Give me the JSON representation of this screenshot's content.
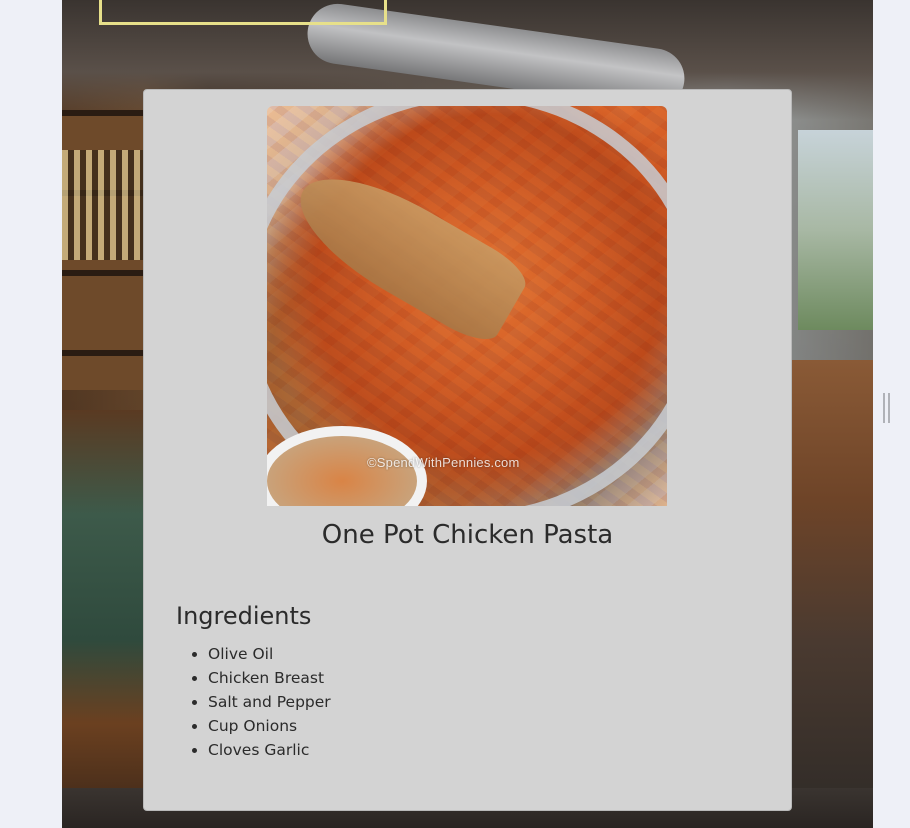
{
  "recipe": {
    "title": "One Pot Chicken Pasta",
    "image_watermark": "©SpendWithPennies.com",
    "ingredients_heading": "Ingredients",
    "ingredients": [
      "Olive Oil",
      "Chicken Breast",
      "Salt and Pepper",
      "Cup Onions",
      "Cloves Garlic"
    ]
  },
  "colors": {
    "page_background": "#eef0f7",
    "card_background": "#d3d3d3",
    "text": "#2b2b2b",
    "sign_outline": "#e7e08a"
  }
}
